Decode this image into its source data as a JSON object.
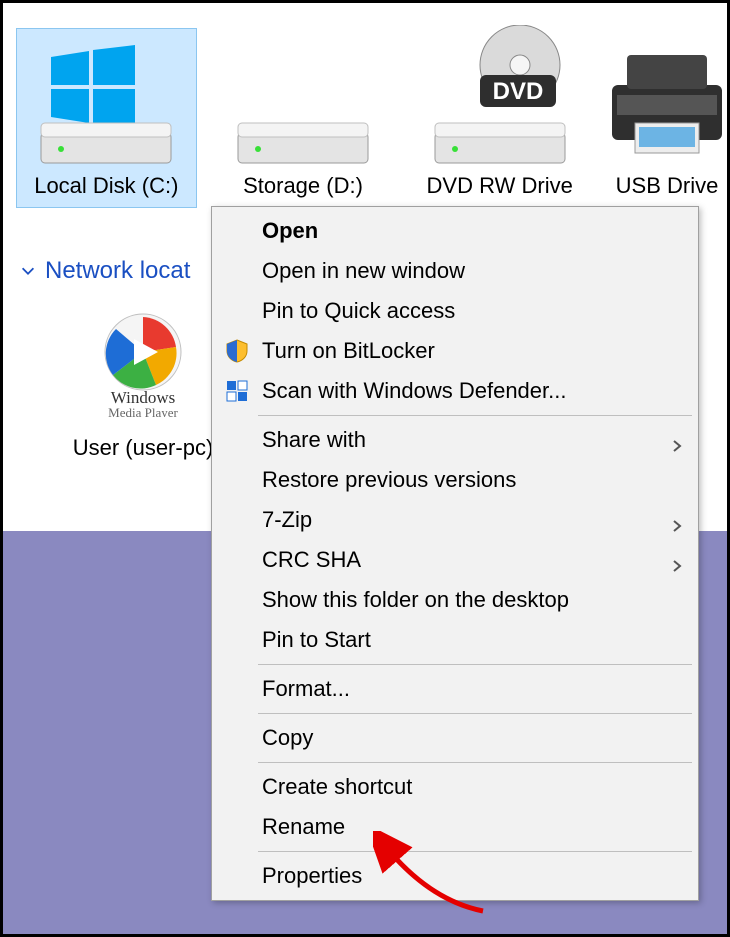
{
  "drives": [
    {
      "label": "Local Disk (C:)",
      "icon": "windows-drive",
      "selected": true
    },
    {
      "label": "Storage (D:)",
      "icon": "drive",
      "selected": false
    },
    {
      "label": "DVD RW Drive",
      "icon": "dvd-drive",
      "selected": false
    },
    {
      "label": "USB Drive",
      "icon": "printer",
      "selected": false
    }
  ],
  "group": {
    "label": "Network locat"
  },
  "network_item": {
    "label": "User (user-pc)"
  },
  "context_menu": {
    "sections": [
      [
        {
          "label": "Open",
          "bold": true,
          "icon": null,
          "submenu": false
        },
        {
          "label": "Open in new window",
          "bold": false,
          "icon": null,
          "submenu": false
        },
        {
          "label": "Pin to Quick access",
          "bold": false,
          "icon": null,
          "submenu": false
        },
        {
          "label": "Turn on BitLocker",
          "bold": false,
          "icon": "bitlocker-icon",
          "submenu": false
        },
        {
          "label": "Scan with Windows Defender...",
          "bold": false,
          "icon": "defender-icon",
          "submenu": false
        }
      ],
      [
        {
          "label": "Share with",
          "bold": false,
          "icon": null,
          "submenu": true
        },
        {
          "label": "Restore previous versions",
          "bold": false,
          "icon": null,
          "submenu": false
        },
        {
          "label": "7-Zip",
          "bold": false,
          "icon": null,
          "submenu": true
        },
        {
          "label": "CRC SHA",
          "bold": false,
          "icon": null,
          "submenu": true
        },
        {
          "label": "Show this folder on the desktop",
          "bold": false,
          "icon": null,
          "submenu": false
        },
        {
          "label": "Pin to Start",
          "bold": false,
          "icon": null,
          "submenu": false
        }
      ],
      [
        {
          "label": "Format...",
          "bold": false,
          "icon": null,
          "submenu": false
        }
      ],
      [
        {
          "label": "Copy",
          "bold": false,
          "icon": null,
          "submenu": false
        }
      ],
      [
        {
          "label": "Create shortcut",
          "bold": false,
          "icon": null,
          "submenu": false
        },
        {
          "label": "Rename",
          "bold": false,
          "icon": null,
          "submenu": false
        }
      ],
      [
        {
          "label": "Properties",
          "bold": false,
          "icon": null,
          "submenu": false
        }
      ]
    ]
  }
}
